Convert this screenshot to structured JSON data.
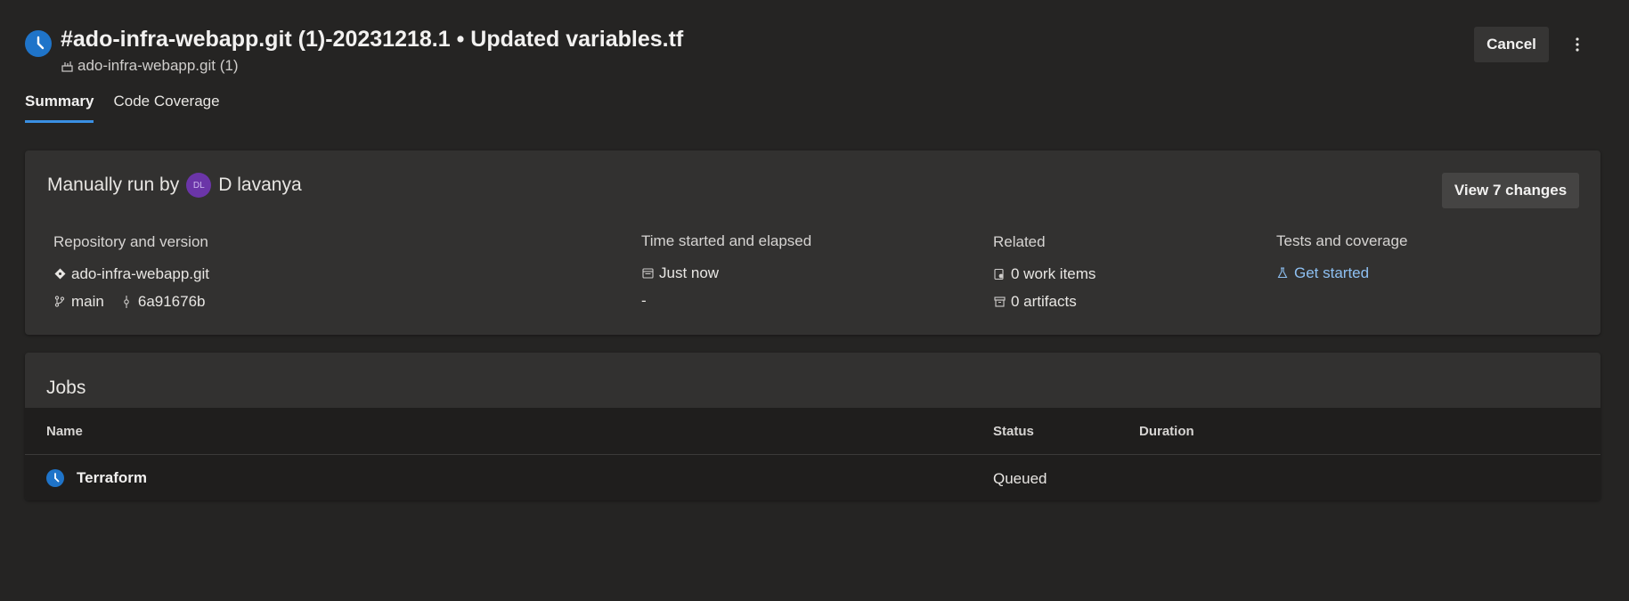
{
  "header": {
    "title": "#ado-infra-webapp.git (1)-20231218.1 • Updated variables.tf",
    "pipeline_name": "ado-infra-webapp.git (1)",
    "cancel_label": "Cancel",
    "more_icon": "more-vertical-icon"
  },
  "tabs": [
    {
      "label": "Summary",
      "active": true
    },
    {
      "label": "Code Coverage",
      "active": false
    }
  ],
  "summary": {
    "run_by_prefix": "Manually run by",
    "avatar_initials": "DL",
    "user_name": "D lavanya",
    "view_changes_label": "View 7 changes",
    "repository": {
      "heading": "Repository and version",
      "repo_name": "ado-infra-webapp.git",
      "branch": "main",
      "commit": "6a91676b"
    },
    "time": {
      "heading": "Time started and elapsed",
      "started": "Just now",
      "elapsed": "-"
    },
    "related": {
      "heading": "Related",
      "work_items": "0 work items",
      "artifacts": "0 artifacts"
    },
    "tests": {
      "heading": "Tests and coverage",
      "link": "Get started"
    }
  },
  "jobs": {
    "title": "Jobs",
    "columns": [
      "Name",
      "Status",
      "Duration"
    ],
    "rows": [
      {
        "name": "Terraform",
        "status": "Queued",
        "duration": ""
      }
    ]
  },
  "colors": {
    "background": "#252423",
    "card": "#323130",
    "accent": "#1f74c9",
    "link": "#8ec0f2",
    "avatar": "#6b35a8"
  }
}
